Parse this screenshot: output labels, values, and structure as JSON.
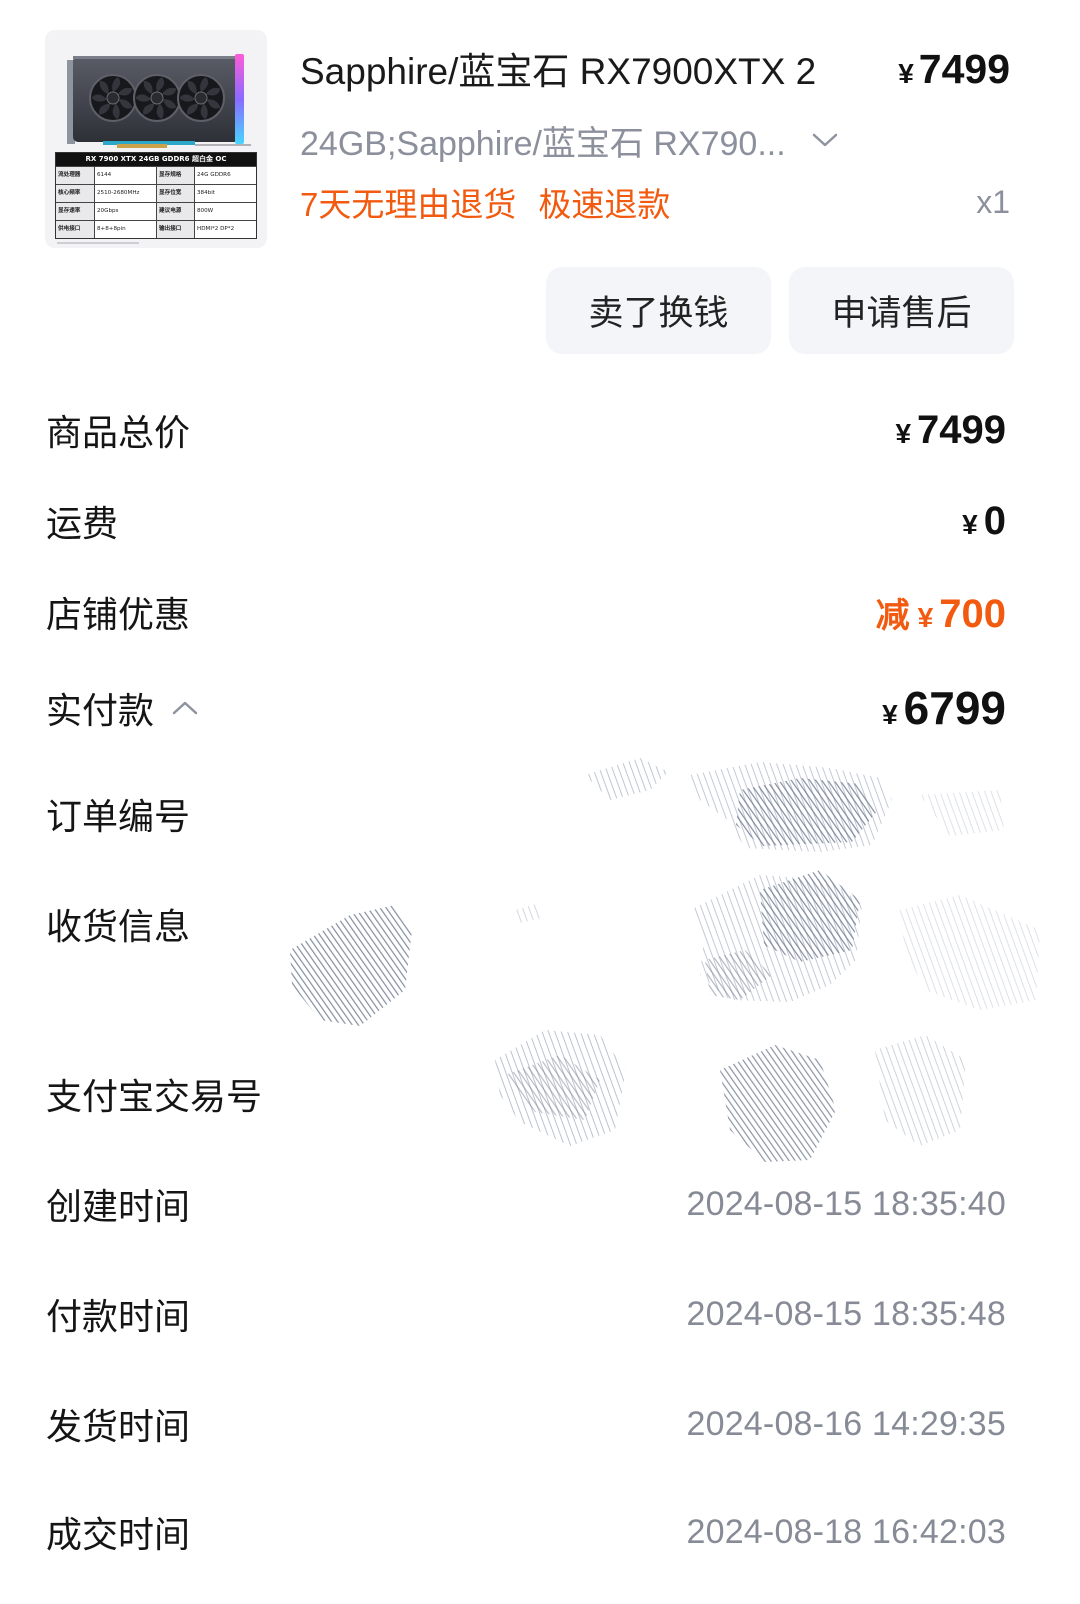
{
  "colors": {
    "accent": "#f25a0f",
    "text_primary": "#151515",
    "text_secondary": "#8c909c",
    "button_bg": "#f4f5f9"
  },
  "product": {
    "image": {
      "table_header": "RX 7900 XTX 24GB GDDR6 超白金 OC",
      "specs": [
        {
          "label_a": "流处理器",
          "value_a": "6144",
          "label_b": "显存规格",
          "value_b": "24G GDDR6"
        },
        {
          "label_a": "核心频率",
          "value_a": "2510-2680MHz",
          "label_b": "显存位宽",
          "value_b": "384bit"
        },
        {
          "label_a": "显存速率",
          "value_a": "20Gbps",
          "label_b": "建议电源",
          "value_b": "800W"
        },
        {
          "label_a": "供电接口",
          "value_a": "8+8+8pin",
          "label_b": "输出接口",
          "value_b": "HDMI*2 DP*2"
        }
      ]
    },
    "title": "Sapphire/蓝宝石 RX7900XTX 2",
    "currency": "¥",
    "price": "7499",
    "sku": "24GB;Sapphire/蓝宝石 RX790...",
    "sku_icon": "chevron-down-icon",
    "tags": [
      "7天无理由退货",
      "极速退款"
    ],
    "quantity": "x1"
  },
  "actions": {
    "resell": "卖了换钱",
    "after_sale": "申请售后"
  },
  "summary": {
    "total": {
      "label": "商品总价",
      "currency": "¥",
      "amount": "7499"
    },
    "shipping": {
      "label": "运费",
      "currency": "¥",
      "amount": "0"
    },
    "discount": {
      "label": "店铺优惠",
      "prefix": "减",
      "currency": "¥",
      "amount": "700"
    },
    "paid": {
      "label": "实付款",
      "icon": "chevron-up-icon",
      "currency": "¥",
      "amount": "6799"
    }
  },
  "order_info": [
    {
      "label": "订单编号"
    },
    {
      "label": "收货信息"
    },
    {
      "label": "支付宝交易号"
    },
    {
      "label": "创建时间",
      "value": "2024-08-15 18:35:40"
    },
    {
      "label": "付款时间",
      "value": "2024-08-15 18:35:48"
    },
    {
      "label": "发货时间",
      "value": "2024-08-16 14:29:35"
    },
    {
      "label": "成交时间",
      "value": "2024-08-18 16:42:03"
    }
  ]
}
